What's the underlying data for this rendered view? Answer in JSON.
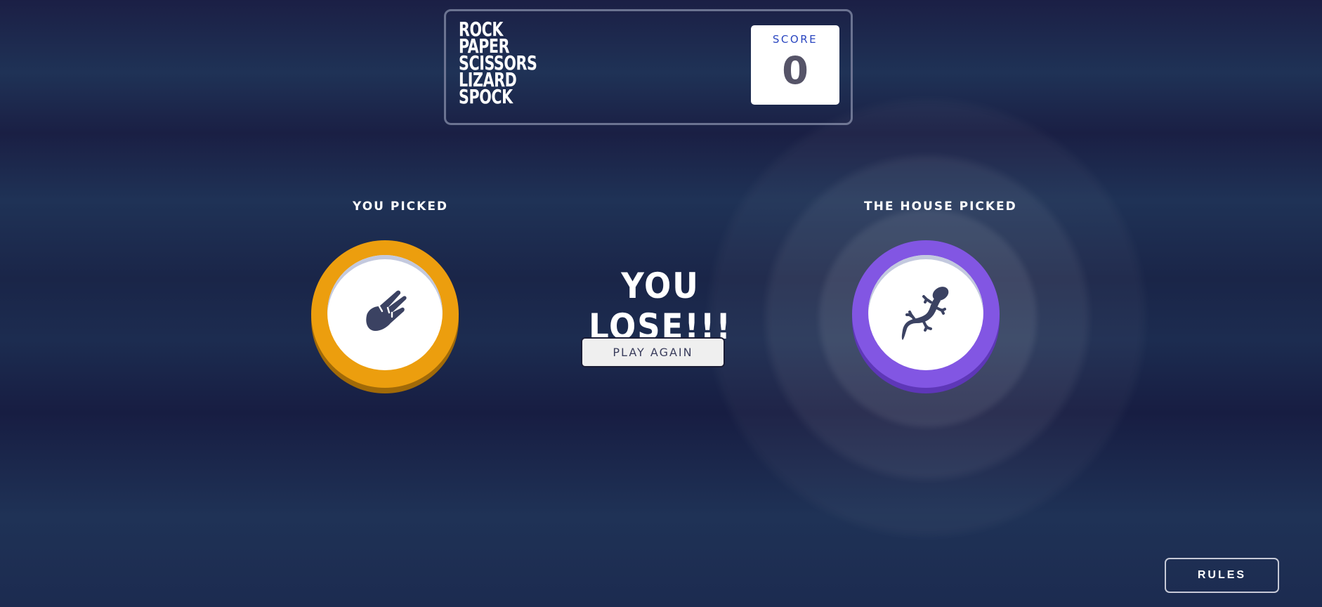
{
  "logo": {
    "lines": [
      "ROCK",
      "PAPER",
      "SCISSORS",
      "LIZARD",
      "SPOCK"
    ]
  },
  "score": {
    "label": "SCORE",
    "value": "0"
  },
  "you_pick": {
    "label": "YOU PICKED",
    "choice": "scissors",
    "icon": "scissors-hand-icon",
    "ring_color": "#ec9e0e"
  },
  "house_pick": {
    "label": "THE HOUSE PICKED",
    "choice": "lizard",
    "icon": "lizard-icon",
    "ring_color": "#8256e3"
  },
  "result": {
    "text": "YOU LOSE!!!",
    "play_again_label": "PLAY AGAIN"
  },
  "rules_label": "RULES"
}
